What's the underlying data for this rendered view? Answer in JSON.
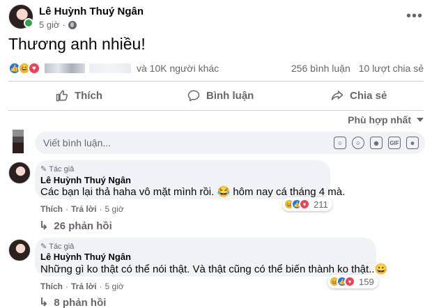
{
  "post": {
    "author": "Lê Huỳnh Thuý Ngân",
    "time": "5 giờ",
    "privacy_icon": "globe-icon",
    "text": "Thương anh nhiều!",
    "reactions_others": "và 10K người khác",
    "comments_count": "256 bình luận",
    "shares_count": "10 lượt chia sẻ"
  },
  "actions": {
    "like": "Thích",
    "comment": "Bình luận",
    "share": "Chia sẻ"
  },
  "sort_label": "Phù hợp nhất",
  "comment_input": {
    "placeholder": "Viết bình luận..."
  },
  "comments": [
    {
      "badge": "Tác giả",
      "author": "Lê Huỳnh Thuý Ngân",
      "text": "Các bạn lại thả haha vô mặt mình rồi. 😂 hôm nay cá tháng 4 mà.",
      "like": "Thích",
      "reply": "Trả lời",
      "time": "5 giờ",
      "reactions": "211",
      "replies": "26 phản hồi"
    },
    {
      "badge": "Tác giả",
      "author": "Lê Huỳnh Thuý Ngân",
      "text": "Những gì ko thật có thể nói thật. Và thật cũng có thể biến thành ko thật..😀",
      "like": "Thích",
      "reply": "Trả lời",
      "time": "5 giờ",
      "reactions": "159",
      "replies": "8 phản hồi"
    }
  ],
  "colors": {
    "accent": "#1877f2",
    "muted": "#65676b",
    "bubble": "#f0f2f5"
  }
}
